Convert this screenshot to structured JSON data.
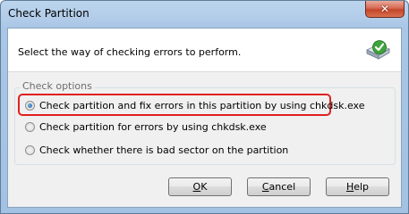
{
  "window": {
    "title": "Check Partition",
    "close_glyph": "✕"
  },
  "header": {
    "instruction": "Select the way of checking errors to perform.",
    "icon": "disk-check-icon"
  },
  "options": {
    "legend": "Check options",
    "items": [
      {
        "label": "Check partition and fix errors in this partition by using chkdsk.exe",
        "checked": true
      },
      {
        "label": "Check partition for errors by using chkdsk.exe",
        "checked": false
      },
      {
        "label": "Check whether there is bad sector on the partition",
        "checked": false
      }
    ]
  },
  "buttons": {
    "ok": {
      "mnemonic": "O",
      "rest": "K"
    },
    "cancel": {
      "mnemonic": "C",
      "rest": "ancel"
    },
    "help": {
      "mnemonic": "H",
      "rest": "elp"
    }
  },
  "colors": {
    "highlight": "#e02020",
    "accent": "#1b5c9a"
  }
}
